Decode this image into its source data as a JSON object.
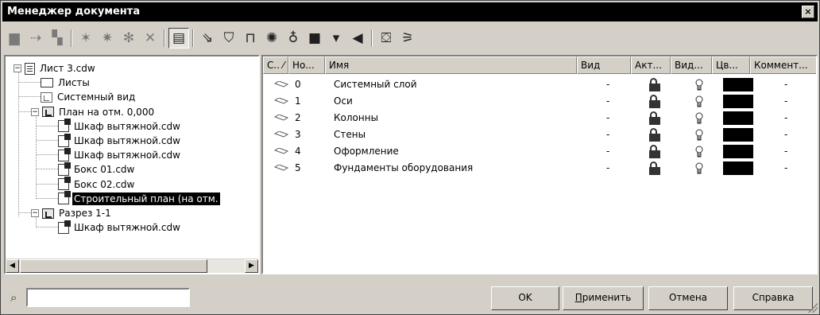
{
  "window": {
    "title": "Менеджер документа",
    "close_label": "×"
  },
  "toolbar": {
    "buttons": [
      {
        "icon": "new-sheet-icon",
        "glyph": "▆"
      },
      {
        "icon": "new-view-icon",
        "glyph": "⇢"
      },
      {
        "icon": "move-icon",
        "glyph": "▚"
      },
      {
        "icon": "new-layer-icon",
        "glyph": "✶"
      },
      {
        "icon": "new-layer-alt-icon",
        "glyph": "✷"
      },
      {
        "icon": "filter-icon",
        "glyph": "✻"
      },
      {
        "icon": "delete-icon",
        "glyph": "✕"
      },
      {
        "icon": "properties-icon",
        "glyph": "▤"
      },
      {
        "icon": "layer-active-icon",
        "glyph": "⇘"
      },
      {
        "icon": "unlock-icon",
        "glyph": "⛉"
      },
      {
        "icon": "lock-icon",
        "glyph": "⊓"
      },
      {
        "icon": "visibility-on-icon",
        "glyph": "✺"
      },
      {
        "icon": "visibility-off-icon",
        "glyph": "♁"
      },
      {
        "icon": "color-icon",
        "glyph": "■"
      },
      {
        "icon": "color-dropdown-icon",
        "glyph": "▾"
      },
      {
        "icon": "brush-icon",
        "glyph": "◀"
      },
      {
        "icon": "export-icon",
        "glyph": "⛋"
      },
      {
        "icon": "settings-icon",
        "glyph": "⚞"
      }
    ]
  },
  "tree": {
    "nodes": [
      {
        "label": "Лист 3.cdw",
        "icon": "document-icon",
        "toggle": "−"
      },
      {
        "label": "Листы",
        "icon": "sheets-icon"
      },
      {
        "label": "Системный вид",
        "icon": "system-view-icon"
      },
      {
        "label": "План на отм. 0,000",
        "icon": "view-icon",
        "toggle": "−"
      },
      {
        "label": "Шкаф вытяжной.cdw",
        "icon": "fragment-icon"
      },
      {
        "label": "Шкаф вытяжной.cdw",
        "icon": "fragment-icon"
      },
      {
        "label": "Шкаф вытяжной.cdw",
        "icon": "fragment-icon"
      },
      {
        "label": "Бокс 01.cdw",
        "icon": "fragment-icon"
      },
      {
        "label": "Бокс 02.cdw",
        "icon": "fragment-icon"
      },
      {
        "label": "Строительный план (на отм.",
        "icon": "fragment-icon"
      },
      {
        "label": "Разрез 1-1",
        "icon": "section-view-icon",
        "toggle": "−"
      },
      {
        "label": "Шкаф вытяжной.cdw",
        "icon": "fragment-icon"
      }
    ],
    "scroll_left": "◀",
    "scroll_right": "▶"
  },
  "layers": {
    "columns": [
      "С.. ⁄",
      "Но...",
      "Имя",
      "Вид",
      "Акт...",
      "Вид...",
      "Цв...",
      "Коммент..."
    ],
    "rows": [
      {
        "no": "0",
        "name": "Системный слой",
        "view": "-",
        "color": "#000000",
        "comment": "-"
      },
      {
        "no": "1",
        "name": "Оси",
        "view": "-",
        "color": "#000000",
        "comment": "-"
      },
      {
        "no": "2",
        "name": "Колонны",
        "view": "-",
        "color": "#000000",
        "comment": "-"
      },
      {
        "no": "3",
        "name": "Стены",
        "view": "-",
        "color": "#000000",
        "comment": "-"
      },
      {
        "no": "4",
        "name": "Оформление",
        "view": "-",
        "color": "#000000",
        "comment": "-"
      },
      {
        "no": "5",
        "name": "Фундаменты оборудования",
        "view": "-",
        "color": "#000000",
        "comment": "-"
      }
    ]
  },
  "footer": {
    "search_value": "",
    "buttons": {
      "ok": "OK",
      "apply_mnemonic": "П",
      "apply_rest": "рименить",
      "cancel": "Отмена",
      "help": "Справка"
    }
  }
}
